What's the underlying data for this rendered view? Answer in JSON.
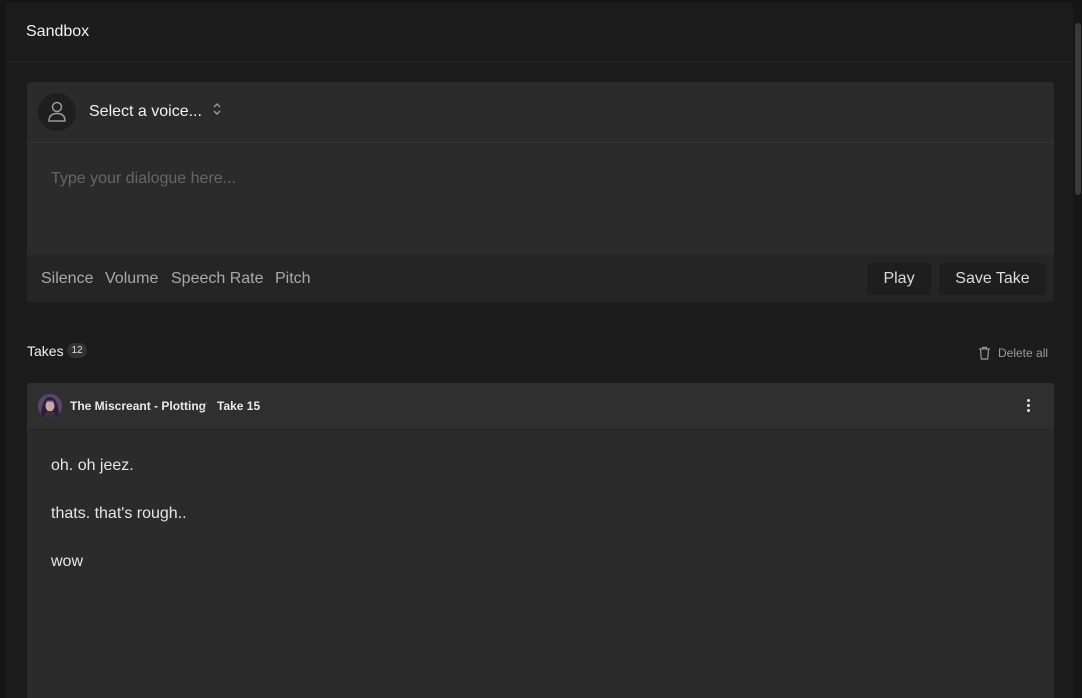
{
  "header": {
    "title": "Sandbox"
  },
  "composer": {
    "voice_select_label": "Select a voice...",
    "dialogue_placeholder": "Type your dialogue here...",
    "tools": [
      "Silence",
      "Volume",
      "Speech Rate",
      "Pitch"
    ],
    "play_label": "Play",
    "save_take_label": "Save Take"
  },
  "takes": {
    "label": "Takes",
    "count": "12",
    "delete_all_label": "Delete all",
    "items": [
      {
        "voice": "The Miscreant - Plotting",
        "separator": "/",
        "take": "Take 15",
        "lines": [
          "oh. oh jeez.",
          "thats. that's rough..",
          "wow"
        ]
      }
    ]
  },
  "icons": {
    "avatar_placeholder": "user-icon",
    "voice_chevrons": "chevron-up-down-icon",
    "delete": "trash-icon",
    "take_menu": "more-vertical-icon"
  }
}
